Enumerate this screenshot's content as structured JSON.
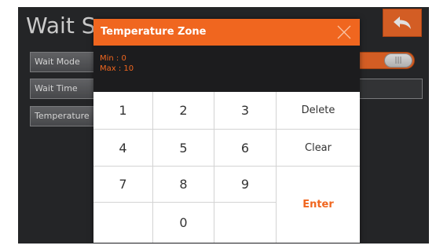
{
  "background_screen": {
    "title": "Wait S",
    "back_icon": "back-arrow-icon",
    "rows": [
      {
        "label": "Wait Mode"
      },
      {
        "label": "Wait Time"
      },
      {
        "label": "Temperature"
      }
    ],
    "toggle": {
      "state": "on",
      "knob_glyph": "|||"
    }
  },
  "dialog": {
    "title": "Temperature Zone",
    "close_icon": "close-icon",
    "range": {
      "min_text": "Min :  0",
      "max_text": "Max : 10"
    },
    "keys": {
      "k1": "1",
      "k2": "2",
      "k3": "3",
      "k4": "4",
      "k5": "5",
      "k6": "6",
      "k7": "7",
      "k8": "8",
      "k9": "9",
      "k0": "0",
      "delete": "Delete",
      "clear": "Clear",
      "enter": "Enter"
    }
  },
  "colors": {
    "accent": "#f0661f",
    "screen_bg": "#2a2b2d",
    "dialog_bg": "#1c1c1e",
    "keypad_bg": "#ffffff"
  }
}
